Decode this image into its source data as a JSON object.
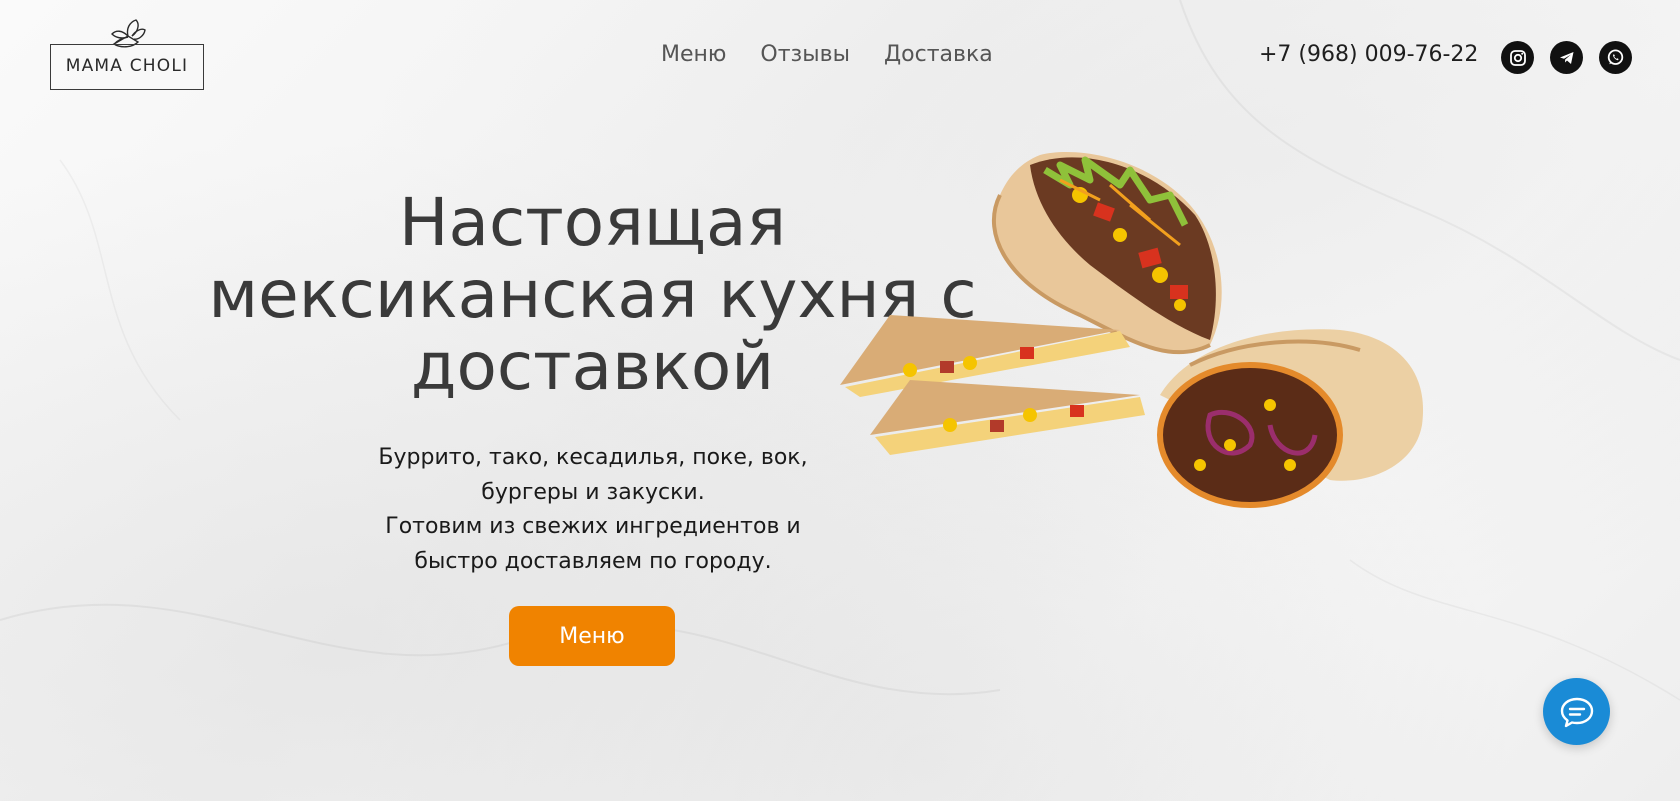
{
  "brand": {
    "logo_text": "MAMA CHOLI"
  },
  "nav": {
    "items": [
      {
        "label": "Меню"
      },
      {
        "label": "Отзывы"
      },
      {
        "label": "Доставка"
      }
    ]
  },
  "contact": {
    "phone": "+7 (968) 009-76-22"
  },
  "socials": [
    {
      "icon": "instagram-icon"
    },
    {
      "icon": "telegram-icon"
    },
    {
      "icon": "whatsapp-icon"
    }
  ],
  "hero": {
    "title_lines": [
      "Настоящая",
      "мексиканская кухня с",
      "доставкой"
    ],
    "description_lines": [
      "Буррито, тако, кесадилья, поке, вок,",
      "бургеры и закуски.",
      "Готовим из свежих ингредиентов и",
      "быстро доставляем по городу."
    ],
    "cta_label": "Меню"
  },
  "chat": {
    "icon": "chat-bubble-icon"
  },
  "colors": {
    "accent": "#f08300",
    "chat": "#1a8bd6",
    "text": "#3a3a3a"
  }
}
